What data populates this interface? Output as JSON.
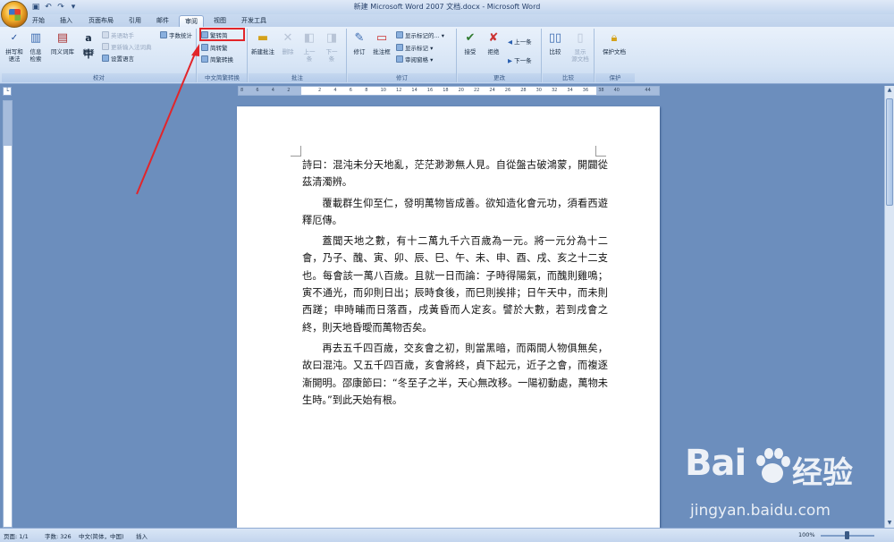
{
  "window": {
    "title": "新建 Microsoft Word 2007 文档.docx - Microsoft Word"
  },
  "tabs": [
    "开始",
    "插入",
    "页面布局",
    "引用",
    "邮件",
    "审阅",
    "视图",
    "开发工具"
  ],
  "active_tab": "审阅",
  "ribbon": {
    "proofing": {
      "label": "校对",
      "spelling": "拼写和\n语法",
      "research": "信息\n检索",
      "thesaurus": "同义词库",
      "translate": "翻译",
      "translate_tip": "英语助手",
      "update_ime": "更新输入法词典",
      "language": "设置语言",
      "word_count": "字数统计"
    },
    "chinese_conv": {
      "label": "中文简繁转换",
      "to_simplified": "繁转简",
      "to_traditional": "简转繁",
      "conversion": "简繁转换"
    },
    "comments": {
      "label": "批注",
      "new": "新建批注",
      "delete": "删除",
      "prev": "上一\n条",
      "next": "下一\n条"
    },
    "tracking": {
      "label": "修订",
      "track": "修订",
      "balloons": "批注框",
      "markup_view": "显示标记的...",
      "show_markup": "显示标记",
      "pane": "审阅窗格"
    },
    "changes": {
      "label": "更改",
      "accept": "接受",
      "reject": "拒绝",
      "prev": "上一条",
      "next": "下一条"
    },
    "compare": {
      "label": "比较",
      "compare": "比较",
      "show_source": "显示\n源文档"
    },
    "protect": {
      "label": "保护",
      "protect_doc": "保护文档"
    }
  },
  "ruler": {
    "numbers": [
      "8",
      "6",
      "4",
      "2",
      "",
      "2",
      "4",
      "6",
      "8",
      "10",
      "12",
      "14",
      "16",
      "18",
      "20",
      "22",
      "24",
      "26",
      "28",
      "30",
      "32",
      "34",
      "36",
      "38",
      "40",
      "",
      "44"
    ]
  },
  "document": {
    "paragraphs": [
      "詩曰：混沌未分天地亂，茫茫渺渺無人見。自從盤古破鴻蒙，開闢從茲清濁辨。",
      "覆載群生仰至仁，發明萬物皆成善。欲知造化會元功，須看西遊釋厄傳。",
      "蓋聞天地之數，有十二萬九千六百歲為一元。將一元分為十二會，乃子、醜、寅、卯、辰、巳、午、未、申、酉、戌、亥之十二支也。每會該一萬八百歲。且就一日而論：子時得陽氣，而醜則雞鳴；寅不通光，而卯則日出；辰時食後，而巳則挨排；日午天中，而未則西蹉；申時晡而日落酉，戌黃昏而人定亥。譬於大數，若到戌會之終，則天地昏曖而萬物否矣。",
      "再去五千四百歲，交亥會之初，則當黑暗，而兩間人物俱無矣，故曰混沌。又五千四百歲，亥會將終，貞下起元，近子之會，而複逐漸開明。邵康節曰：“冬至子之半，天心無改移。一陽初動處，萬物未生時。”到此天始有根。"
    ]
  },
  "status": {
    "page": "页面: 1/1",
    "words": "字数: 326",
    "language": "中文(简体，中国)",
    "mode": "插入",
    "zoom": "100%"
  },
  "watermark": {
    "brand": "Bai",
    "cn": "经验",
    "url": "jingyan.baidu.com"
  }
}
